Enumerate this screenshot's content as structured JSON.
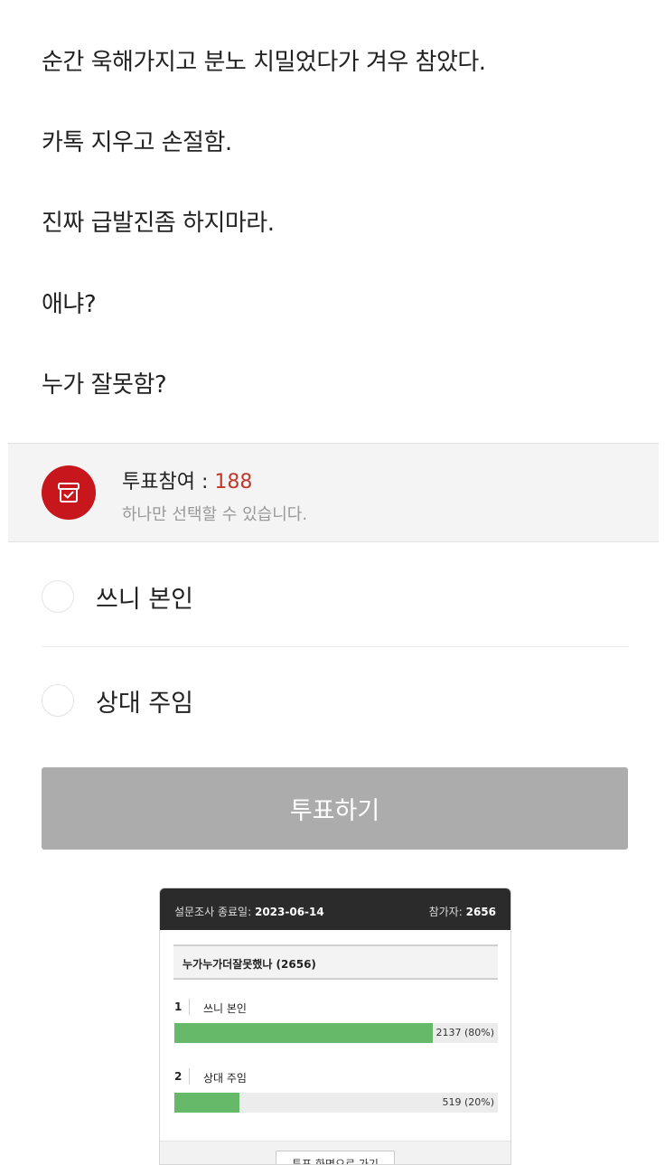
{
  "post": {
    "lines": [
      "순간 욱해가지고 분노 치밀었다가 겨우 참았다.",
      "카톡 지우고 손절함.",
      "진짜 급발진좀 하지마라.",
      "애냐?",
      "누가 잘못함?"
    ]
  },
  "vote": {
    "count_label": "투표참여 :",
    "count": "188",
    "description": "하나만 선택할 수 있습니다.",
    "options": [
      "쓰니 본인",
      "상대 주임"
    ],
    "submit_label": "투표하기",
    "accent_color": "#c8161d"
  },
  "survey": {
    "end_label": "설문조사 종료일:",
    "end_date": "2023-06-14",
    "participants_label": "참가자:",
    "participants": "2656",
    "question": "누가누가더잘못했나 (2656)",
    "results": [
      {
        "num": "1",
        "label": "쓰니 본인",
        "value_text": "2137 (80%)",
        "percent": 80
      },
      {
        "num": "2",
        "label": "상대 주임",
        "value_text": "519 (20%)",
        "percent": 20
      }
    ],
    "goto_label": "투표 화면으로 가기",
    "bar_color": "#66b968"
  }
}
